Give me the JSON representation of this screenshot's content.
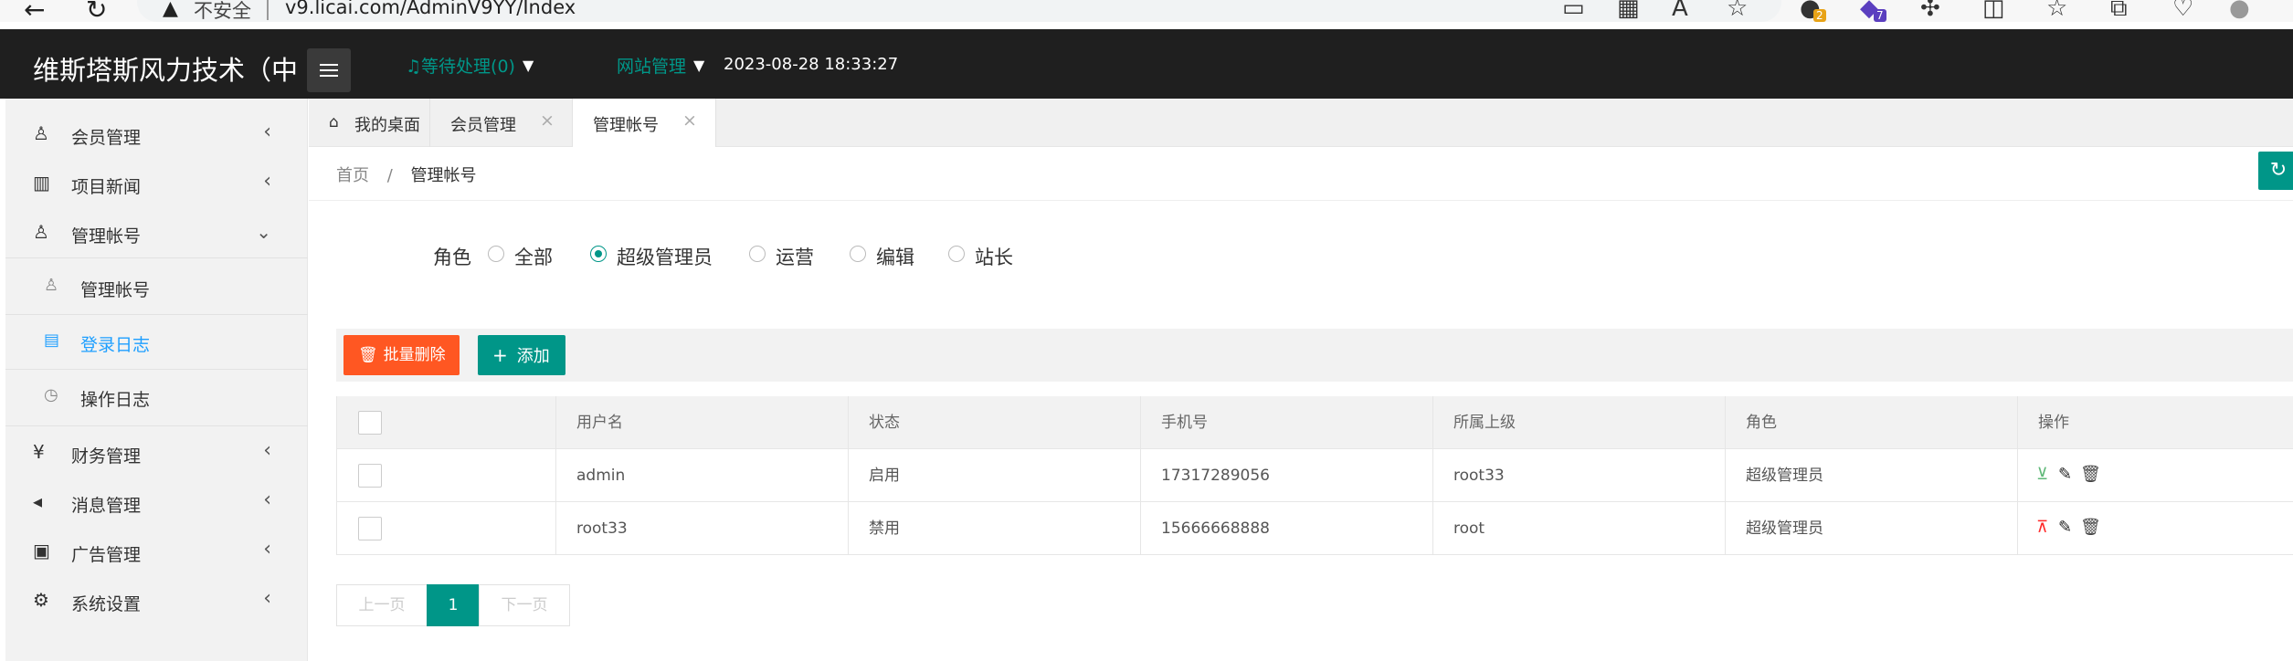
{
  "browser": {
    "insecure_label": "不安全",
    "url": "v9.licai.com/AdminV9YY/Index",
    "badge1": "2",
    "badge2": "7"
  },
  "header": {
    "title": "维斯塔斯风力技术（中",
    "pending": "♫等待处理(0)",
    "site_mgmt": "网站管理",
    "datetime": "2023-08-28 18:33:27"
  },
  "sidebar": {
    "items": [
      {
        "label": "会员管理",
        "icon": "user-icon"
      },
      {
        "label": "项目新闻",
        "icon": "book-icon"
      },
      {
        "label": "管理帐号",
        "icon": "users-icon"
      },
      {
        "label": "财务管理",
        "icon": "yen-icon"
      },
      {
        "label": "消息管理",
        "icon": "speaker-icon"
      },
      {
        "label": "广告管理",
        "icon": "image-icon"
      },
      {
        "label": "系统设置",
        "icon": "gear-icon"
      }
    ],
    "sub_items": [
      {
        "label": "管理帐号"
      },
      {
        "label": "登录日志"
      },
      {
        "label": "操作日志"
      }
    ]
  },
  "tabs": [
    {
      "label": "我的桌面"
    },
    {
      "label": "会员管理"
    },
    {
      "label": "管理帐号"
    }
  ],
  "breadcrumb": {
    "home": "首页",
    "sep": "/",
    "current": "管理帐号"
  },
  "filter": {
    "label": "角色",
    "options": [
      "全部",
      "超级管理员",
      "运营",
      "编辑",
      "站长"
    ],
    "selected": "超级管理员"
  },
  "toolbar": {
    "delete_label": "批量删除",
    "add_label": "添加"
  },
  "table": {
    "columns": [
      "用户名",
      "状态",
      "手机号",
      "所属上级",
      "角色",
      "操作"
    ],
    "rows": [
      {
        "username": "admin",
        "status": "启用",
        "phone": "17317289056",
        "parent": "root33",
        "role": "超级管理员"
      },
      {
        "username": "root33",
        "status": "禁用",
        "phone": "15666668888",
        "parent": "root",
        "role": "超级管理员"
      }
    ]
  },
  "pagination": {
    "prev": "上一页",
    "current": "1",
    "next": "下一页"
  },
  "colors": {
    "accent": "#009688",
    "danger": "#ff5722",
    "active_link": "#1e9fff",
    "header_bg": "#1f1f1f"
  }
}
